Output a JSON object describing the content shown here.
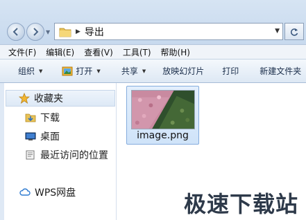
{
  "address": {
    "path": "导出"
  },
  "menu": [
    "文件(F)",
    "编辑(E)",
    "查看(V)",
    "工具(T)",
    "帮助(H)"
  ],
  "toolbar": {
    "organize": "组织",
    "open": "打开",
    "share": "共享",
    "slideshow": "放映幻灯片",
    "print": "打印",
    "new_folder": "新建文件夹"
  },
  "nav": {
    "favorites": "收藏夹",
    "downloads": "下载",
    "desktop": "桌面",
    "recent": "最近访问的位置",
    "wps": "WPS网盘"
  },
  "files": [
    {
      "name": "image.png"
    }
  ],
  "watermark": "极速下载站",
  "colors": {
    "accent": "#84acdd",
    "selection": "#cfe3f9"
  },
  "icons": {
    "back": "back-arrow-icon",
    "forward": "forward-arrow-icon",
    "folder": "folder-icon",
    "refresh": "refresh-icon",
    "favorites": "star-icon",
    "downloads": "download-folder-icon",
    "desktop": "desktop-icon",
    "recent": "recent-places-icon",
    "wps": "cloud-icon",
    "open": "image-viewer-icon"
  }
}
